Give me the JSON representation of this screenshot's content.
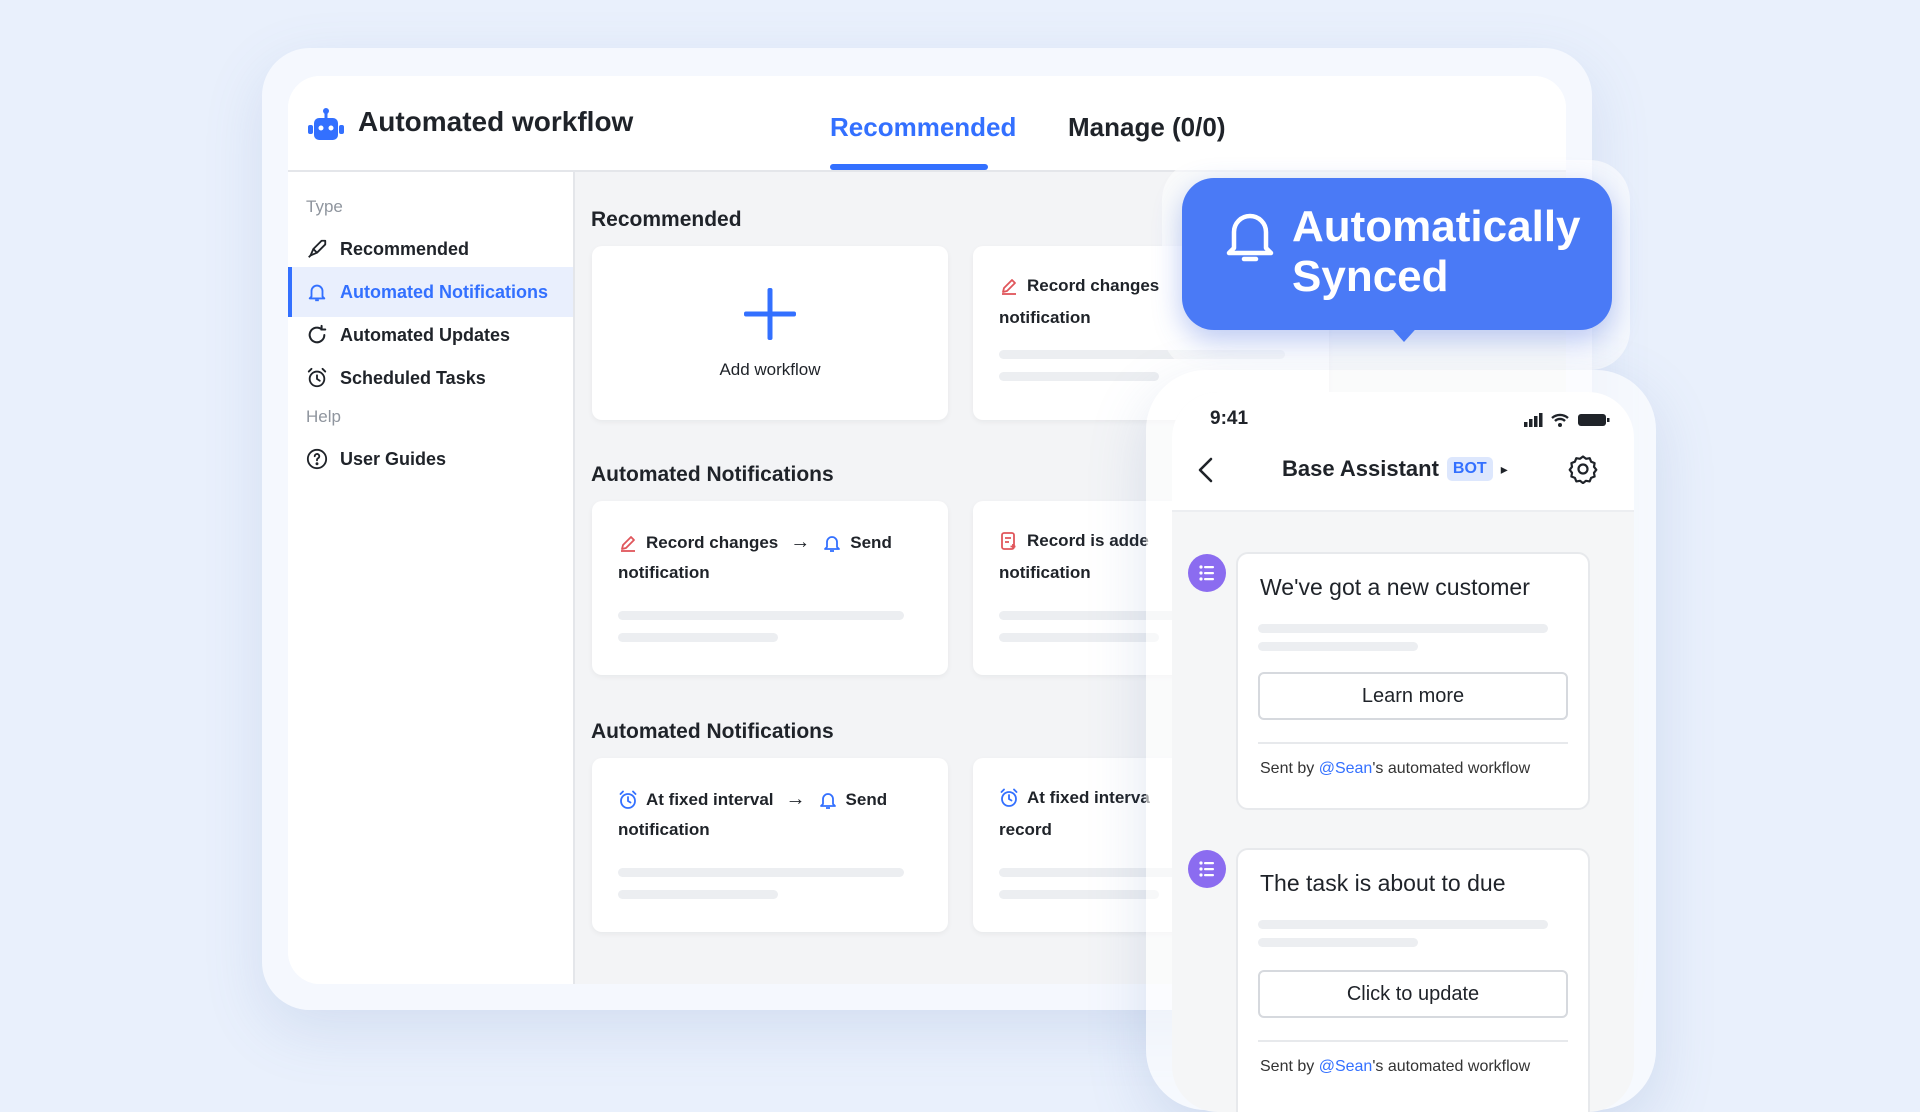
{
  "app": {
    "title": "Automated workflow",
    "tabs": {
      "recommended": "Recommended",
      "manage": "Manage (0/0)"
    }
  },
  "sidebar": {
    "type_label": "Type",
    "help_label": "Help",
    "items": [
      {
        "label": "Recommended"
      },
      {
        "label": "Automated Notifications"
      },
      {
        "label": "Automated Updates"
      },
      {
        "label": "Scheduled Tasks"
      },
      {
        "label": "User Guides"
      }
    ]
  },
  "content": {
    "sections": [
      {
        "title": "Recommended"
      },
      {
        "title": "Automated Notifications"
      },
      {
        "title": "Automated Notifications"
      }
    ],
    "add_card": {
      "label": "Add workflow"
    },
    "cards": {
      "rec_1": {
        "line1": "Record changes",
        "line2": "notification"
      },
      "notif_1": {
        "trigger": "Record changes",
        "action": "Send",
        "line2": "notification"
      },
      "notif_2": {
        "line1": "Record is adde",
        "line2": "notification"
      },
      "sched_1": {
        "trigger": "At fixed interval",
        "action": "Send",
        "line2": "notification"
      },
      "sched_2": {
        "line1": "At fixed interva",
        "line2": "record"
      }
    },
    "arrow": "→"
  },
  "bubble": {
    "line1": "Automatically",
    "line2": "Synced"
  },
  "phone": {
    "time": "9:41",
    "chat_title": "Base Assistant",
    "bot_badge": "BOT",
    "caret": "▸",
    "messages": [
      {
        "title": "We've got a new customer",
        "button": "Learn more",
        "sent_by": "Sent by",
        "mention": "@Sean",
        "suffix": "'s automated workflow"
      },
      {
        "title": "The task is about to due",
        "button": "Click to update",
        "sent_by": "Sent by",
        "mention": "@Sean",
        "suffix": "'s automated workflow"
      }
    ]
  },
  "colors": {
    "accent": "#3370ff",
    "bubble": "#4a7af6",
    "avatar": "#8b6cf0"
  }
}
